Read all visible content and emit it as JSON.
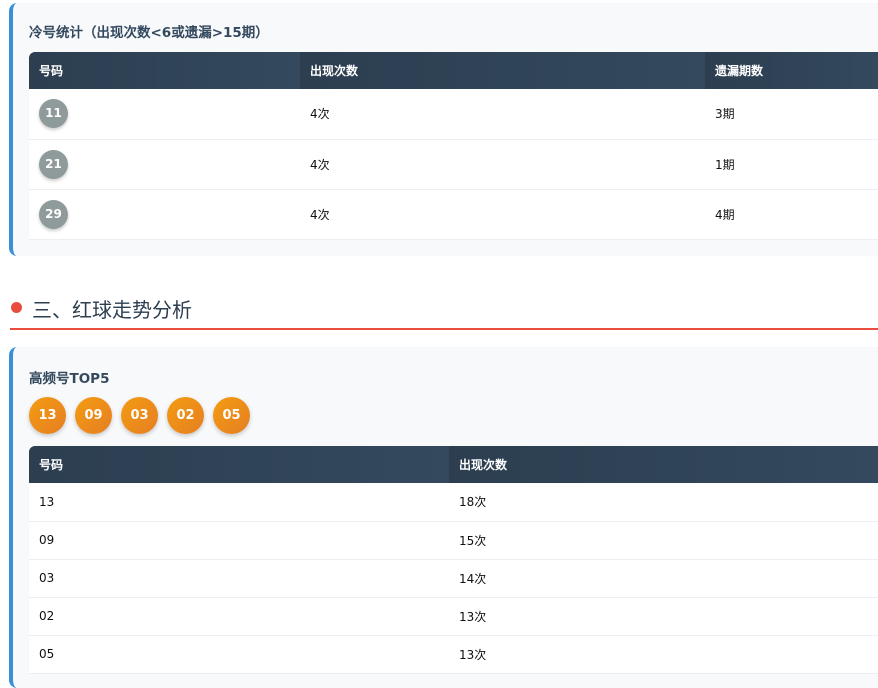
{
  "cold": {
    "title": "冷号统计（出现次数<6或遗漏>15期）",
    "headers": [
      "号码",
      "出现次数",
      "遗漏期数"
    ],
    "rows": [
      {
        "num": "11",
        "count": "4次",
        "miss": "3期"
      },
      {
        "num": "21",
        "count": "4次",
        "miss": "1期"
      },
      {
        "num": "29",
        "count": "4次",
        "miss": "4期"
      }
    ]
  },
  "section": {
    "title": "三、红球走势分析"
  },
  "hot": {
    "title": "高频号TOP5",
    "balls": [
      "13",
      "09",
      "03",
      "02",
      "05"
    ],
    "headers": [
      "号码",
      "出现次数"
    ],
    "rows": [
      {
        "num": "13",
        "count": "18次"
      },
      {
        "num": "09",
        "count": "15次"
      },
      {
        "num": "03",
        "count": "14次"
      },
      {
        "num": "02",
        "count": "13次"
      },
      {
        "num": "05",
        "count": "13次"
      }
    ]
  },
  "colors": {
    "accent": "#3b8fd8",
    "red": "#e74c3c",
    "orange": "#f39c12",
    "gray": "#8f9a9a"
  }
}
